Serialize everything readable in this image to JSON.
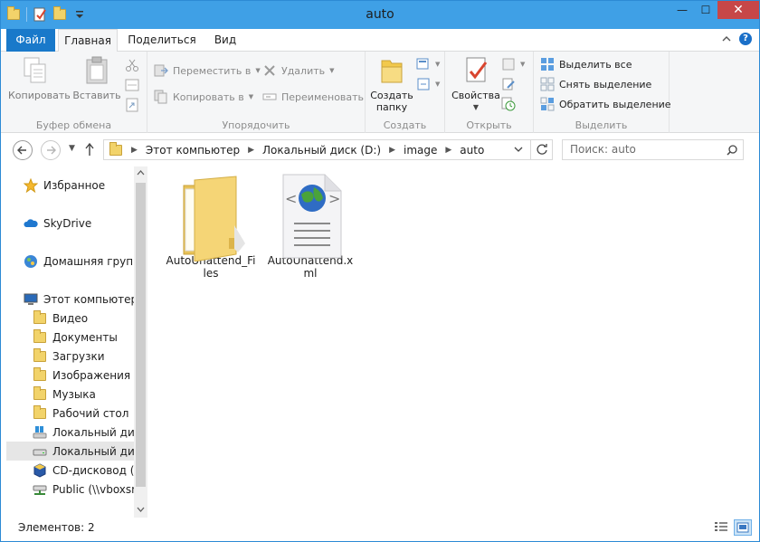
{
  "window": {
    "title": "auto"
  },
  "title_controls": {
    "minimize": "—",
    "maximize": "☐",
    "close": "✕"
  },
  "tabs": {
    "file": "Файл",
    "home": "Главная",
    "share": "Поделиться",
    "view": "Вид"
  },
  "ribbon": {
    "clipboard": {
      "label": "Буфер обмена",
      "copy": "Копировать",
      "paste": "Вставить"
    },
    "organize": {
      "label": "Упорядочить",
      "move_to": "Переместить в",
      "copy_to": "Копировать в",
      "delete": "Удалить",
      "rename": "Переименовать"
    },
    "create": {
      "label": "Создать",
      "new_folder_line1": "Создать",
      "new_folder_line2": "папку"
    },
    "open": {
      "label": "Открыть",
      "properties": "Свойства"
    },
    "select": {
      "label": "Выделить",
      "select_all": "Выделить все",
      "select_none": "Снять выделение",
      "invert": "Обратить выделение"
    }
  },
  "address": {
    "crumbs": [
      "Этот компьютер",
      "Локальный диск (D:)",
      "image",
      "auto"
    ],
    "search_placeholder": "Поиск: auto"
  },
  "nav": {
    "favorites": "Избранное",
    "skydrive": "SkyDrive",
    "homegroup": "Домашняя группа",
    "this_pc": "Этот компьютер",
    "items": [
      "Видео",
      "Документы",
      "Загрузки",
      "Изображения",
      "Музыка",
      "Рабочий стол",
      "Локальный диск",
      "Локальный диск",
      "CD-дисковод (E:",
      "Public (\\\\vboxsrv"
    ]
  },
  "files": [
    {
      "name": "AutoUnattend_Files",
      "type": "folder",
      "icon": "folder-icon"
    },
    {
      "name": "AutoUnattend.xml",
      "type": "xml",
      "icon": "xml-file-icon"
    }
  ],
  "status": {
    "count": "Элементов: 2"
  },
  "colors": {
    "titlebar": "#3fa0e6",
    "file_tab": "#1979ca",
    "close": "#c74748",
    "folder": "#f2d36a"
  }
}
